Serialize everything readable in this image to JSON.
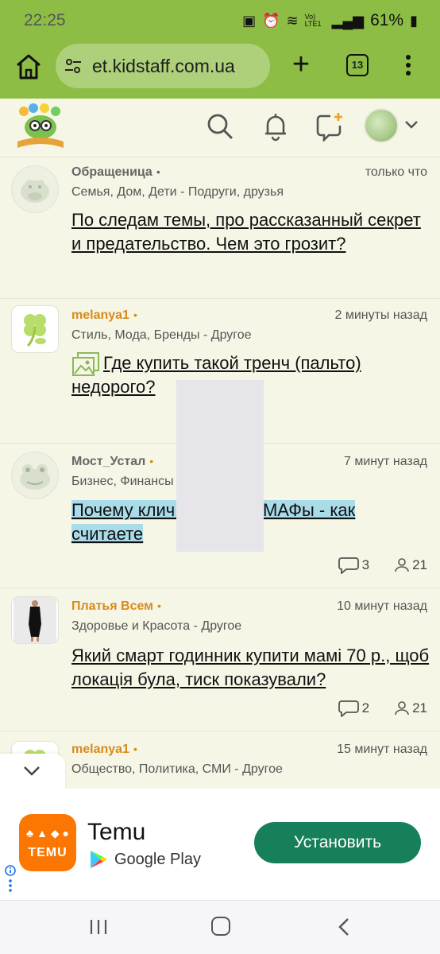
{
  "status_bar": {
    "time": "22:25",
    "network_label": "Vo) LTE1",
    "battery": "61%"
  },
  "browser": {
    "url": "et.kidstaff.com.ua",
    "tab_count": "13"
  },
  "feed": [
    {
      "author": "Обращеница",
      "author_color": "#666666",
      "dot": "•",
      "time": "только что",
      "category": "Семья, Дом, Дети - Подруги, друзья",
      "title": "По следам темы, про рассказанный секрет и предательство. Чем это грозит?"
    },
    {
      "author": "melanya1",
      "author_color": "#d98a18",
      "dot": "•",
      "time": "2 минуты назад",
      "category": "Стиль, Мода, Бренды - Другое",
      "title": "Где купить такой тренч (пальто) недорого?"
    },
    {
      "author": "Мост_Устал",
      "author_color": "#666666",
      "dot": "•",
      "time": "7 минут назад",
      "category": "Бизнес, Финансы",
      "title": "Почему клич                 во сносит МАФы - как считаете",
      "comments": "3",
      "participants": "21"
    },
    {
      "author": "Платья Всем",
      "author_color": "#d98a18",
      "dot": "•",
      "time": "10 минут назад",
      "category": "Здоровье и Красота - Другое",
      "title": "Який смарт годинник купити мамі 70 р., щоб локація була, тиск показували?",
      "comments": "2",
      "participants": "21"
    },
    {
      "author": "melanya1",
      "author_color": "#d98a18",
      "dot": "•",
      "time": "15 минут назад",
      "category": "Общество, Политика, СМИ - Другое"
    }
  ],
  "ad": {
    "app_name": "Temu",
    "store": "Google Play",
    "install_label": "Установить",
    "logo_text": "TEMU",
    "brand_color": "#fb7701",
    "button_color": "#17805a"
  },
  "colors": {
    "chrome_bar": "#8dbd44",
    "page_bg": "#f6f6e6",
    "highlight": "#a9dbe8"
  }
}
